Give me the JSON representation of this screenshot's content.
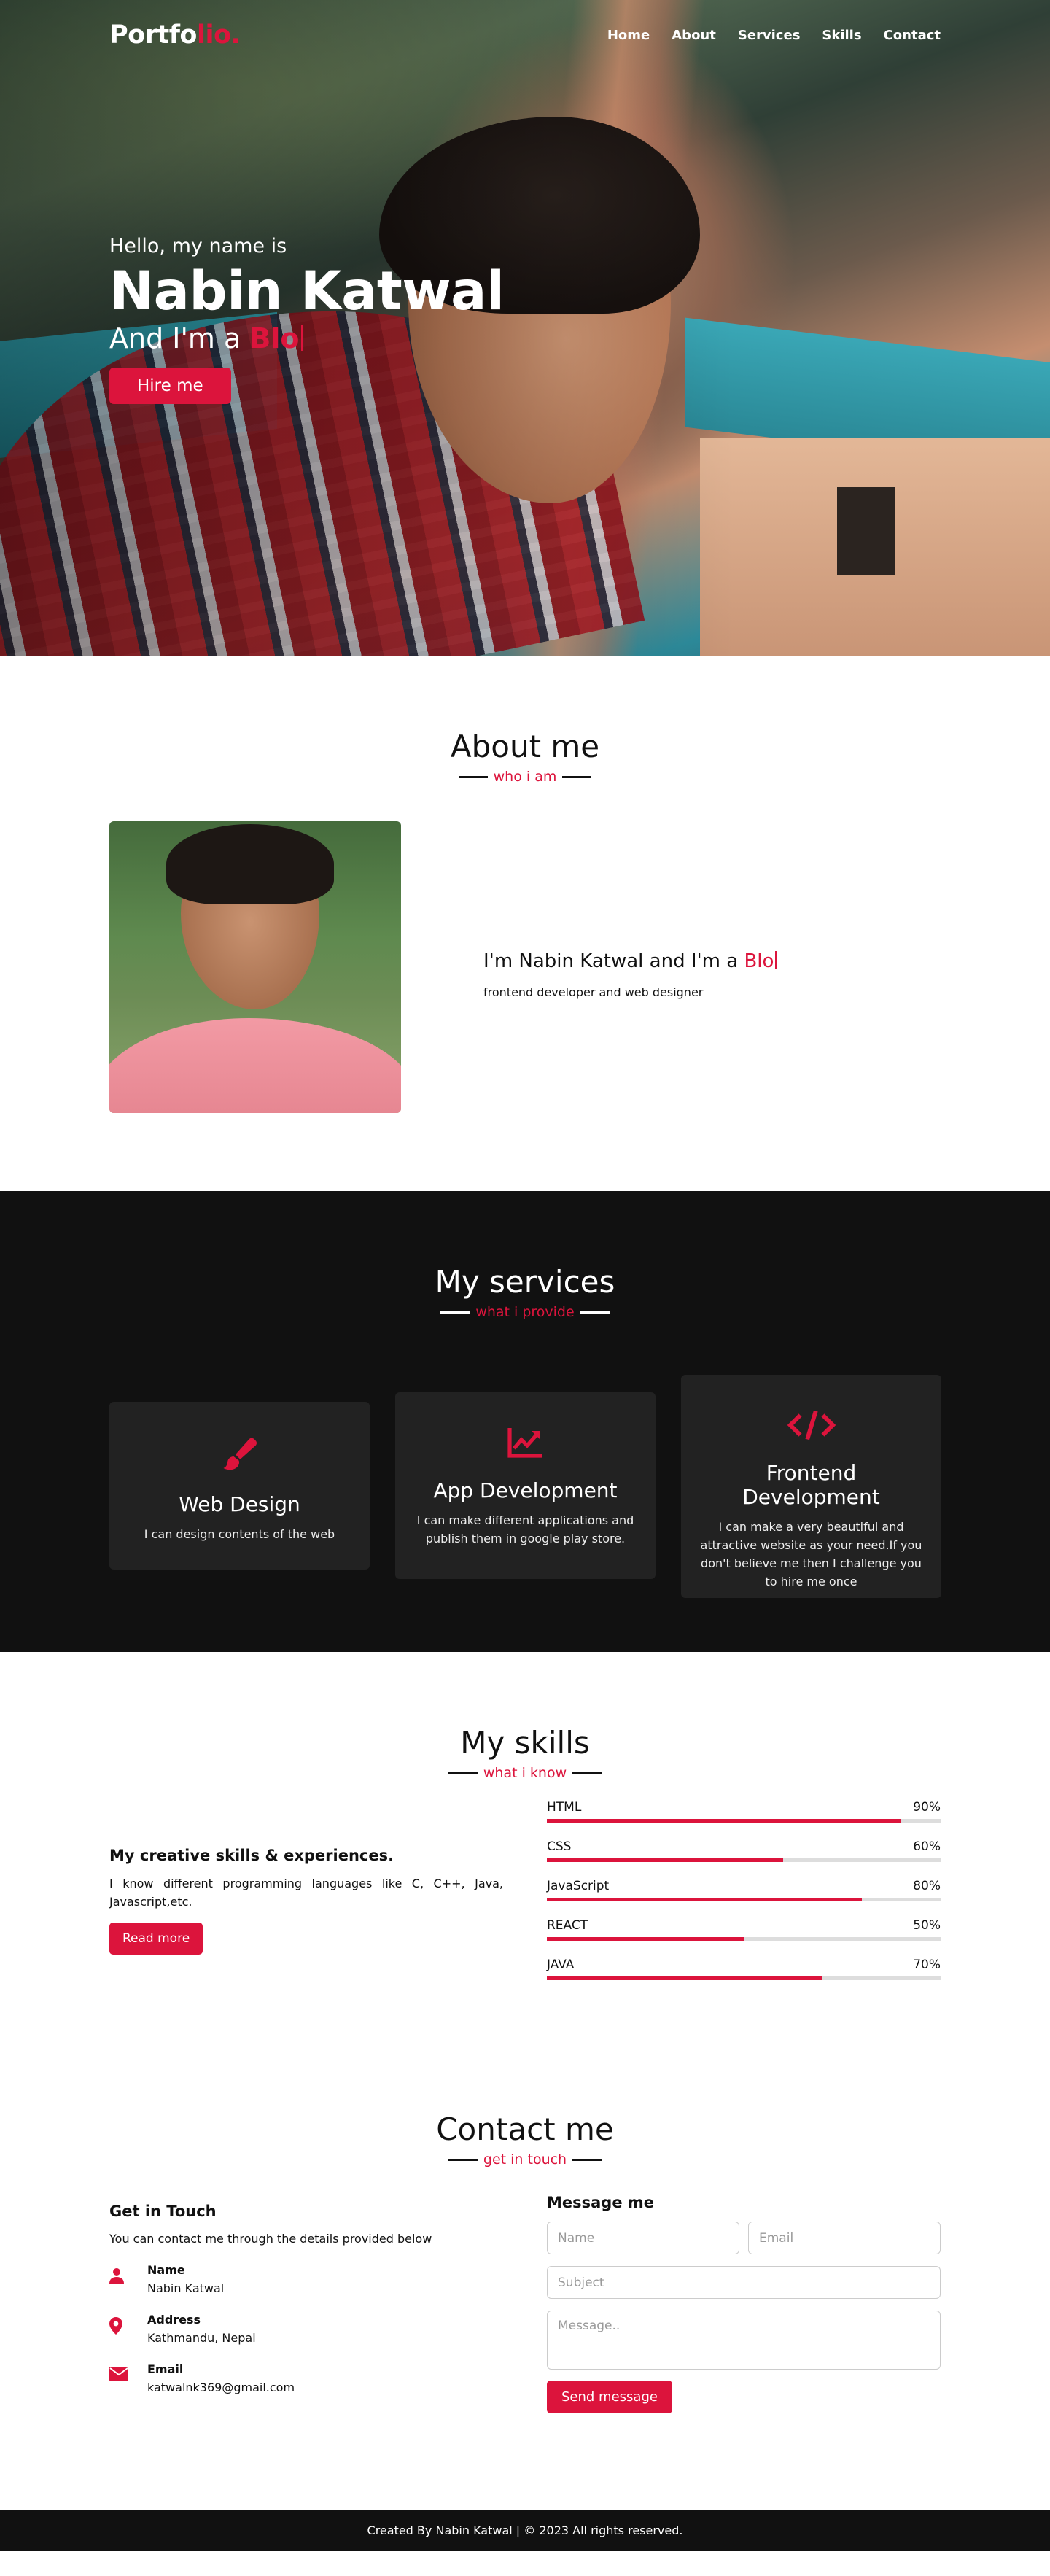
{
  "nav": {
    "logo_main": "Portfo",
    "logo_accent": "lio.",
    "items": [
      "Home",
      "About",
      "Services",
      "Skills",
      "Contact"
    ]
  },
  "hero": {
    "greeting": "Hello, my name is",
    "name": "Nabin Katwal",
    "role_prefix": "And I'm a",
    "role_typed": "Blo",
    "cta": "Hire me"
  },
  "about": {
    "title": "About me",
    "subtitle": "who i am",
    "heading_prefix": "I'm Nabin Katwal and I'm a",
    "heading_typed": "Blo",
    "description": "frontend developer and web designer"
  },
  "services": {
    "title": "My services",
    "subtitle": "what i provide",
    "cards": [
      {
        "icon": "paint-brush-icon",
        "title": "Web Design",
        "desc": "I can design contents of the web"
      },
      {
        "icon": "chart-line-icon",
        "title": "App Development",
        "desc": "I can make different applications and publish them in google play store."
      },
      {
        "icon": "code-icon",
        "title": "Frontend Development",
        "desc": "I can make a very beautiful and attractive website as your need.If you don't believe me then I challenge you to hire me once"
      }
    ]
  },
  "skills": {
    "title": "My skills",
    "subtitle": "what i know",
    "heading": "My creative skills & experiences.",
    "text": "I know different programming languages like C, C++, Java, Javascript,etc.",
    "button": "Read more",
    "bars": [
      {
        "name": "HTML",
        "percent": "90%",
        "value": 0.9
      },
      {
        "name": "CSS",
        "percent": "60%",
        "value": 0.6
      },
      {
        "name": "JavaScript",
        "percent": "80%",
        "value": 0.8
      },
      {
        "name": "REACT",
        "percent": "50%",
        "value": 0.5
      },
      {
        "name": "JAVA",
        "percent": "70%",
        "value": 0.7
      }
    ]
  },
  "contact": {
    "title": "Contact me",
    "subtitle": "get in touch",
    "left_heading": "Get in Touch",
    "left_text": "You can contact me through the details provided below",
    "info": [
      {
        "icon": "user-icon",
        "label": "Name",
        "value": "Nabin Katwal"
      },
      {
        "icon": "map-marker-icon",
        "label": "Address",
        "value": "Kathmandu, Nepal"
      },
      {
        "icon": "envelope-icon",
        "label": "Email",
        "value": "katwalnk369@gmail.com"
      }
    ],
    "form_heading": "Message me",
    "placeholders": {
      "name": "Name",
      "email": "Email",
      "subject": "Subject",
      "message": "Message.."
    },
    "send": "Send message"
  },
  "footer": {
    "text_prefix": "Created By",
    "author": "Nabin Katwal",
    "text_suffix": "| © 2023 All rights reserved."
  },
  "colors": {
    "accent": "#dc143c",
    "dark": "#111111",
    "card": "#222222"
  }
}
